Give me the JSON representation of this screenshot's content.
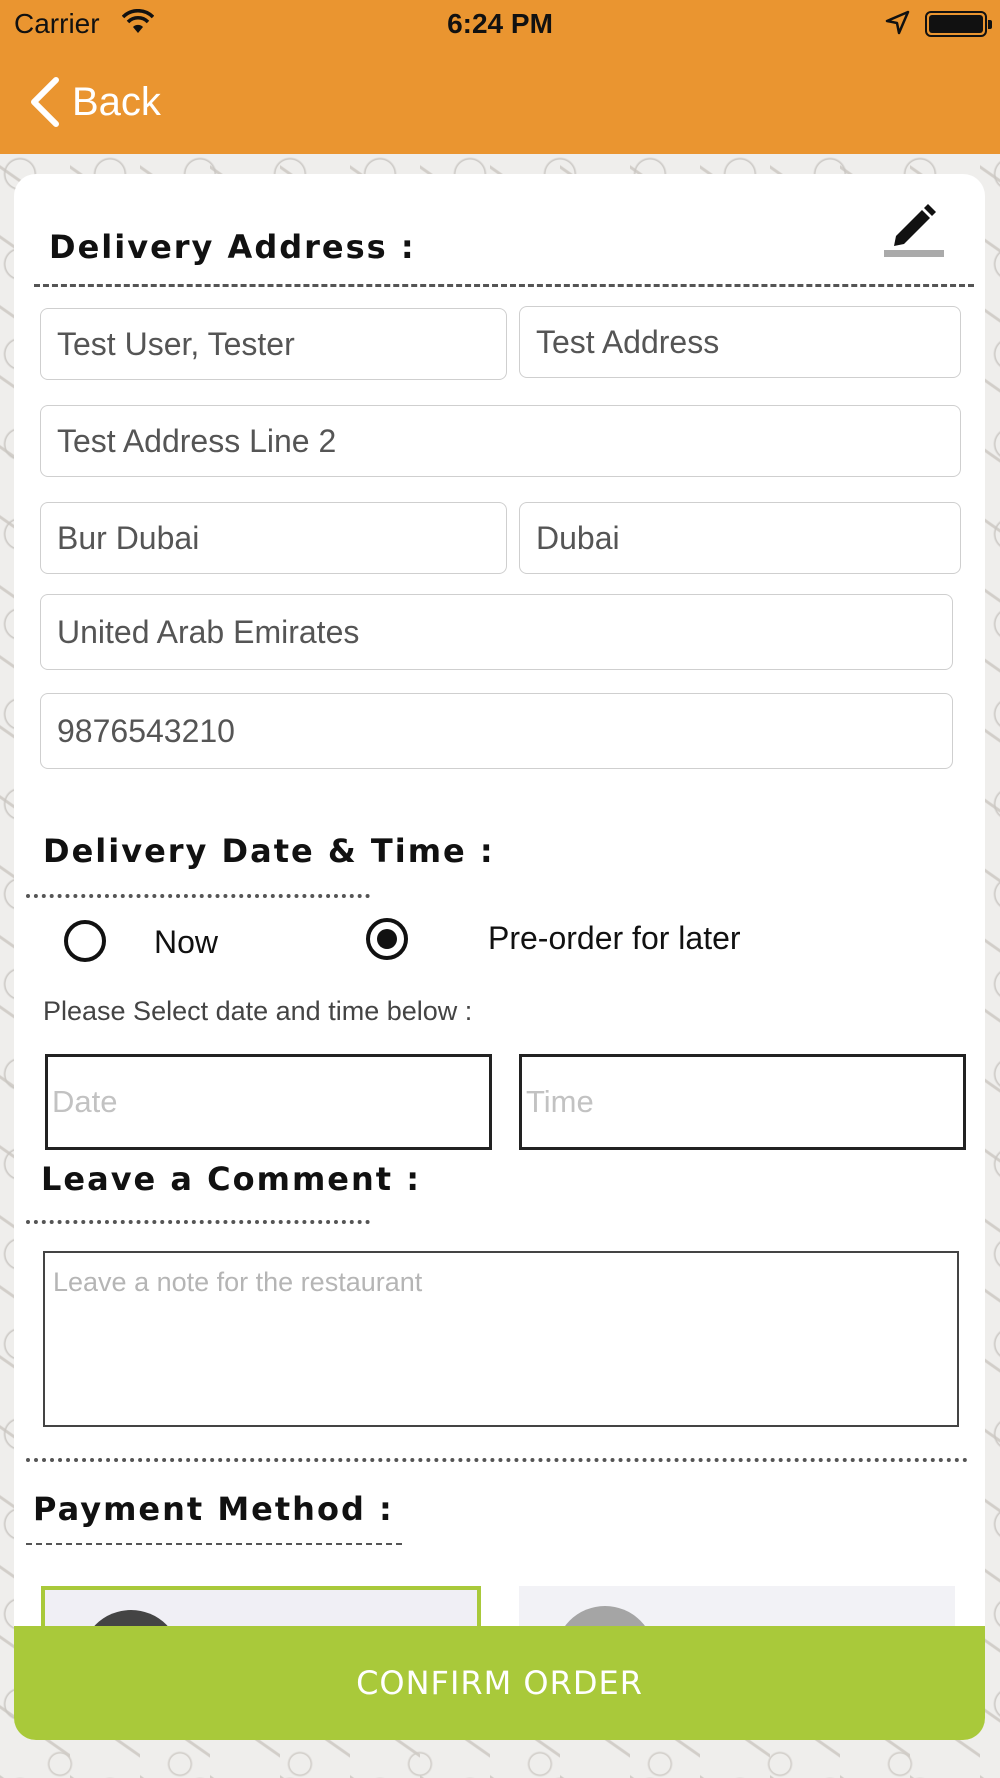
{
  "status_bar": {
    "carrier": "Carrier",
    "time": "6:24 PM"
  },
  "nav": {
    "back_label": "Back"
  },
  "delivery_address": {
    "title": "Delivery Address :",
    "name": "Test User, Tester",
    "address_line_1": "Test Address",
    "address_line_2": "Test Address Line 2",
    "area": "Bur Dubai",
    "city": "Dubai",
    "country": "United Arab Emirates",
    "phone": "9876543210"
  },
  "delivery_time": {
    "title": "Delivery Date & Time :",
    "options": [
      {
        "label": "Now",
        "selected": false
      },
      {
        "label": "Pre-order for later",
        "selected": true
      }
    ],
    "hint": "Please Select date and time below :",
    "date_placeholder": "Date",
    "time_placeholder": "Time"
  },
  "comment": {
    "title": "Leave a Comment :",
    "placeholder": "Leave a note for the restaurant"
  },
  "payment": {
    "title": "Payment Method :"
  },
  "confirm_label": "CONFIRM ORDER",
  "colors": {
    "header": "#ea9530",
    "accent_green": "#a9c93a"
  }
}
